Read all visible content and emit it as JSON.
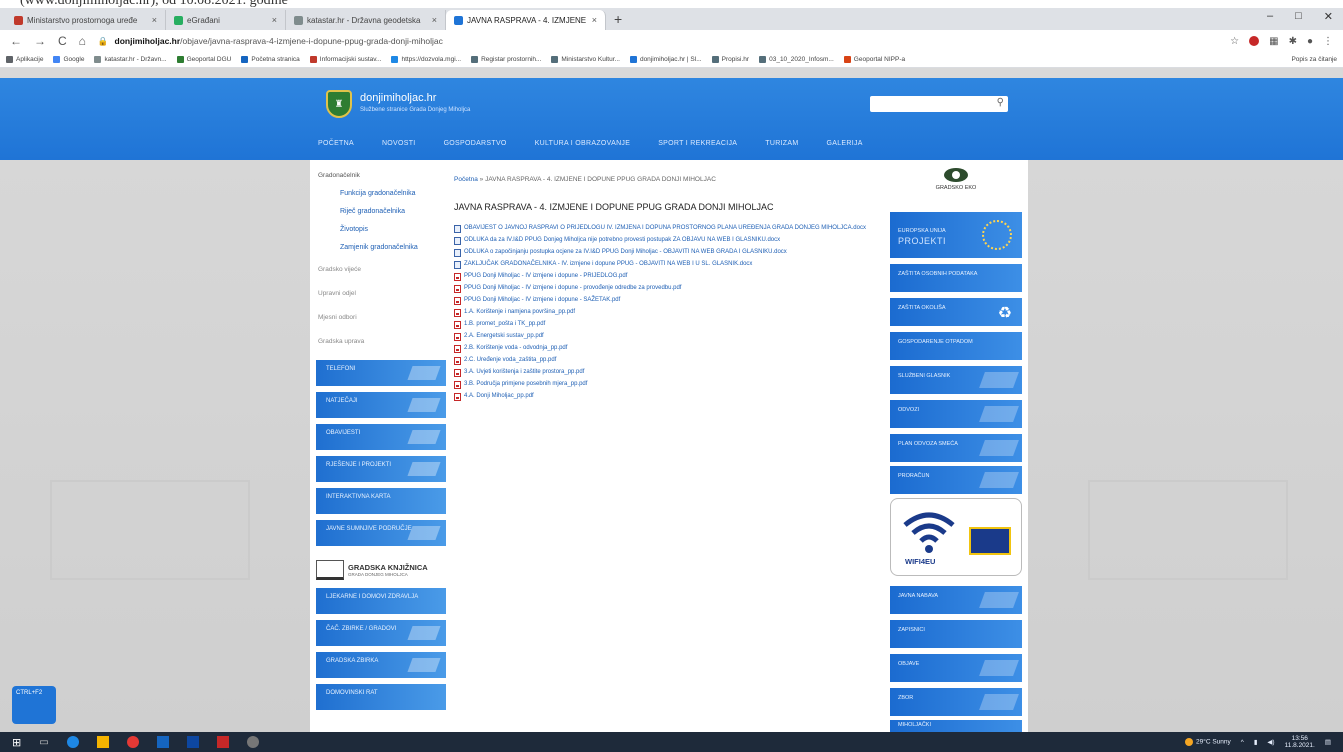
{
  "browser": {
    "tabs": [
      {
        "label": "Ministarstvo prostornoga uređe",
        "color": "#c0392b",
        "active": false
      },
      {
        "label": "eGrađani",
        "color": "#27ae60",
        "active": false
      },
      {
        "label": "katastar.hr - Državna geodetska",
        "color": "#7f8c8d",
        "active": false
      },
      {
        "label": "JAVNA RASPRAVA - 4. IZMJENE",
        "color": "#1f74d6",
        "active": true
      }
    ],
    "new_tab": "+",
    "window_controls": [
      "–",
      "□",
      "✕"
    ],
    "url_host": "donjimiholjac.hr",
    "url_path": "/objave/javna-rasprava-4-izmjene-i-dopune-ppug-grada-donji-miholjac",
    "bookmarks": [
      {
        "label": "Aplikacije",
        "color": "#5f6368"
      },
      {
        "label": "Google",
        "color": "#4285f4"
      },
      {
        "label": "katastar.hr - Državn...",
        "color": "#7f8c8d"
      },
      {
        "label": "Geoportal DGU",
        "color": "#2e7d32"
      },
      {
        "label": "Početna stranica",
        "color": "#1565c0"
      },
      {
        "label": "Informacijski sustav...",
        "color": "#c0392b"
      },
      {
        "label": "https://dozvola.mgi...",
        "color": "#1e88e5"
      },
      {
        "label": "Registar prostornih...",
        "color": "#546e7a"
      },
      {
        "label": "Ministarstvo Kultur...",
        "color": "#546e7a"
      },
      {
        "label": "donjimiholjac.hr | Sl...",
        "color": "#1f74d6"
      },
      {
        "label": "Propisi.hr",
        "color": "#546e7a"
      },
      {
        "label": "03_10_2020_Infosm...",
        "color": "#546e7a"
      },
      {
        "label": "Geoportal NIPP-a",
        "color": "#d84315"
      }
    ],
    "bookmarks_right": "Popis za čitanje"
  },
  "site": {
    "name": "donjimiholjac.hr",
    "subtitle": "Službene stranice Grada Donjeg Miholjca",
    "nav": [
      "POČETNA",
      "NOVOSTI",
      "GOSPODARSTVO",
      "KULTURA I OBRAZOVANJE",
      "SPORT I REKREACIJA",
      "TURIZAM",
      "GALERIJA"
    ]
  },
  "left": {
    "head": "Gradonačelnik",
    "sub": [
      "Funkcija gradonačelnika",
      "Riječ gradonačelnika",
      "Životopis",
      "Zamjenik gradonačelnika"
    ],
    "gray": [
      "Gradsko vijeće",
      "Upravni odjel",
      "Mjesni odbori",
      "Gradska uprava"
    ],
    "banners": [
      "TELEFONI",
      "NATJEČAJI",
      "OBAVIJESTI",
      "RJEŠENJE I PROJEKTI",
      "INTERAKTIVNA KARTA",
      "JAVNE SUMNJIVE PODRUČJE"
    ],
    "library": {
      "title": "GRADSKA KNJIŽNICA",
      "sub": "GRADA DONJEG MIHOLJCA"
    },
    "banners2": [
      "LJEKARNE I DOMOVI ZDRAVLJA",
      "ČAČ. ZBIRKE / GRADOVI",
      "GRADSKA ZBIRKA",
      "DOMOVINSKI RAT"
    ]
  },
  "breadcrumb": {
    "home": "Početna",
    "rest": "» JAVNA RASPRAVA - 4. IZMJENE I DOPUNE PPUG GRADA DONJI MIHOLJAC"
  },
  "page_title": "JAVNA RASPRAVA - 4. IZMJENE I DOPUNE PPUG GRADA DONJI MIHOLJAC",
  "files": [
    {
      "type": "doc",
      "name": "OBAVIJEST O JAVNOJ RASPRAVI O PRIJEDLOGU IV. IZMJENA I DOPUNA PROSTORNOG PLANA UREĐENJA GRADA DONJEG MIHOLJCA.docx"
    },
    {
      "type": "doc",
      "name": "ODLUKA da za IV.I&D PPUG Donjeg Miholjca nije potrebno provesti postupak ZA OBJAVU NA WEB I GLASNIKU.docx"
    },
    {
      "type": "doc",
      "name": "ODLUKA o započinjanju postupka ocjene za IV.I&D PPUG Donji Miholjac - OBJAVITI NA WEB GRADA I GLASNIKU.docx"
    },
    {
      "type": "doc",
      "name": "ZAKLJUČAK GRADONAČELNIKA - IV. izmjene i dopune PPUG - OBJAVITI NA WEB I U SL. GLASNIK.docx"
    },
    {
      "type": "pdf",
      "name": "PPUG Donji Miholjac - IV izmjene i dopune - PRIJEDLOG.pdf"
    },
    {
      "type": "pdf",
      "name": "PPUG Donji Miholjac - IV izmjene i dopune - provođenje odredbe za provedbu.pdf"
    },
    {
      "type": "pdf",
      "name": "PPUG Donji Miholjac - IV izmjene i dopune - SAŽETAK.pdf"
    },
    {
      "type": "pdf",
      "name": "1.A. Korištenje i namjena površina_pp.pdf"
    },
    {
      "type": "pdf",
      "name": "1.B. promet_pošta i TK_pp.pdf"
    },
    {
      "type": "pdf",
      "name": "2.A. Energetski sustav_pp.pdf"
    },
    {
      "type": "pdf",
      "name": "2.B. Korištenje voda - odvodnja_pp.pdf"
    },
    {
      "type": "pdf",
      "name": "2.C. Uređenje voda_zaštita_pp.pdf"
    },
    {
      "type": "pdf",
      "name": "3.A. Uvjeti korištenja i zaštite prostora_pp.pdf"
    },
    {
      "type": "pdf",
      "name": "3.B. Područja primjene posebnih mjera_pp.pdf"
    },
    {
      "type": "pdf",
      "name": "4.A. Donji Miholjac_pp.pdf"
    }
  ],
  "right": {
    "eko_label": "GRADSKO EKO",
    "eu_label": "EUROPSKA UNIJA",
    "eu_sub": "PROJEKTI",
    "banners": [
      "ZAŠTITA OSOBNIH PODATAKA",
      "ZAŠTITA OKOLIŠA",
      "GOSPODARENJE OTPADOM",
      "SLUŽBENI GLASNIK",
      "ODVOZI",
      "PLAN ODVOZA SMEĆA",
      "PRORAČUN"
    ],
    "wifi_label": "WIFI4EU",
    "banners2": [
      "JAVNA NABAVA",
      "ZAPISNICI",
      "OBJAVE",
      "ZBOR",
      "MIHOLJAČKI"
    ]
  },
  "ctrl_label": "CTRL+F2",
  "taskbar": {
    "weather": "29°C Sunny",
    "time": "13:56",
    "date": "11.8.2021."
  }
}
